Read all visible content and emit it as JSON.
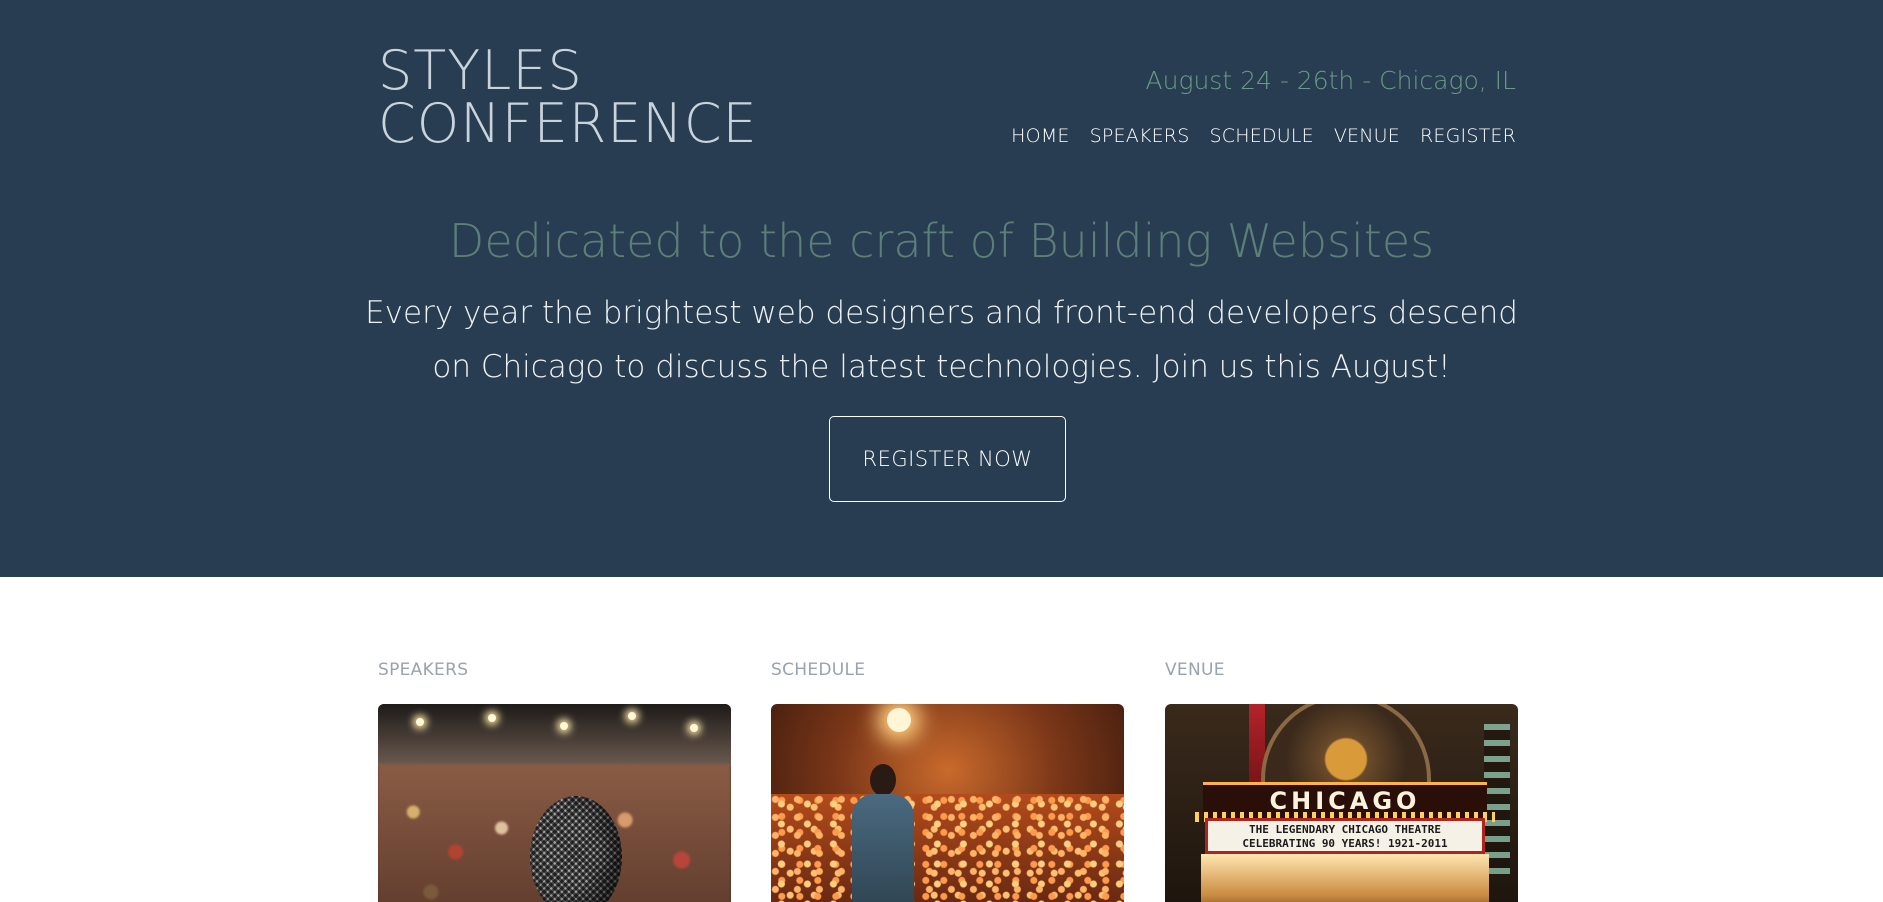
{
  "site": {
    "logo_line1": "STYLES",
    "logo_line2": "CONFERENCE",
    "dateline": "August 24 - 26th - Chicago, IL"
  },
  "nav": {
    "items": [
      {
        "label": "HOME"
      },
      {
        "label": "SPEAKERS"
      },
      {
        "label": "SCHEDULE"
      },
      {
        "label": "VENUE"
      },
      {
        "label": "REGISTER"
      }
    ]
  },
  "hero": {
    "tagline": "Dedicated to the craft of Building Websites",
    "lead": "Every year the brightest web designers and front-end developers descend on Chicago to discuss the latest technologies. Join us this August!",
    "cta_label": "REGISTER NOW"
  },
  "teasers": [
    {
      "heading": "SPEAKERS"
    },
    {
      "heading": "SCHEDULE"
    },
    {
      "heading": "VENUE"
    }
  ],
  "venue_photo": {
    "sign": "CHICAGO",
    "board_line1": "THE LEGENDARY CHICAGO THEATRE",
    "board_line2": "CELEBRATING 90 YEARS! 1921-2011"
  },
  "colors": {
    "hero_bg": "#293d52",
    "tagline": "#5d7f7a",
    "dateline": "#6b9a8a",
    "section_heading": "#9aa3ab"
  }
}
